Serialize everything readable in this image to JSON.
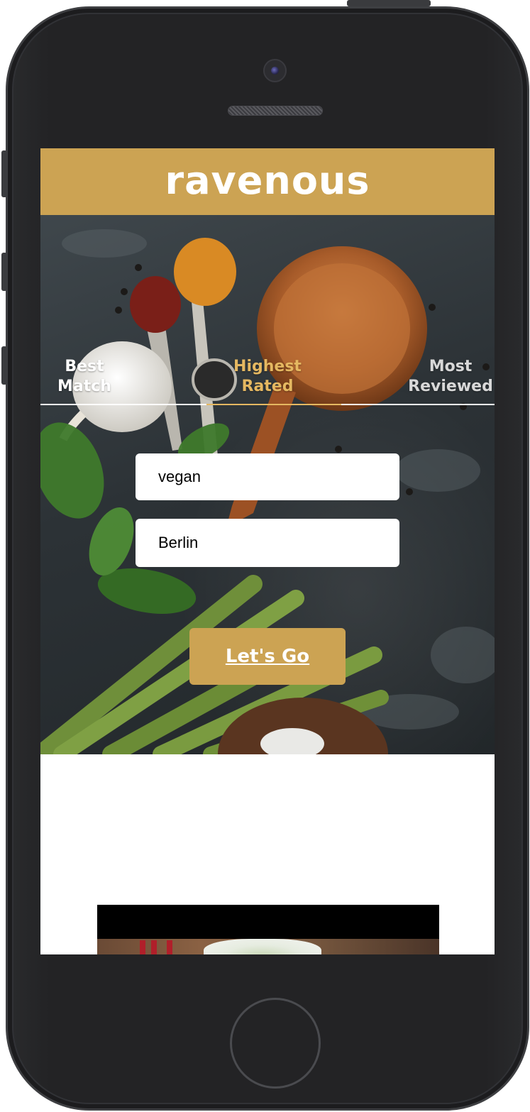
{
  "app": {
    "title": "ravenous"
  },
  "sort_options": [
    {
      "label_line1": "Best",
      "label_line2": "Match",
      "state": "default"
    },
    {
      "label_line1": "Highest",
      "label_line2": "Rated",
      "state": "active"
    },
    {
      "label_line1": "Most",
      "label_line2": "Reviewed",
      "state": "muted"
    }
  ],
  "search": {
    "term_value": "vegan",
    "location_value": "Berlin",
    "submit_label": "Let's Go"
  },
  "colors": {
    "brand": "#cca353",
    "active_tab": "#e5b861",
    "header_text": "#ffffff"
  },
  "icons": {
    "hero_image": "kitchen-spices-photo",
    "result_image": "food-dish-photo"
  }
}
